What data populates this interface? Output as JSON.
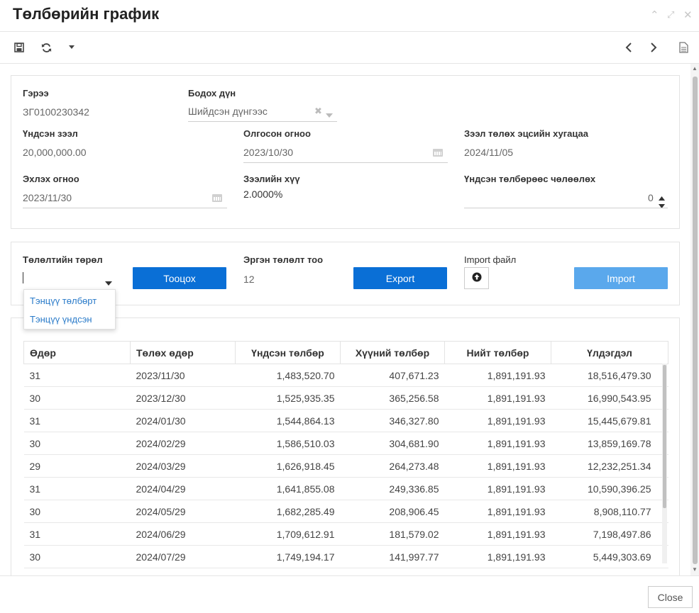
{
  "window": {
    "title": "Төлбөрийн график"
  },
  "icons": {
    "save": "save-icon",
    "refresh": "refresh-icon",
    "more": "caret-down-icon",
    "prev": "chevron-left-icon",
    "next": "chevron-right-icon",
    "doc": "document-icon",
    "upload": "arrow-up-circle-icon",
    "calendar": "calendar-icon"
  },
  "form": {
    "contract": {
      "label": "Гэрээ",
      "value": "ЗГ0100230342"
    },
    "calc_amount": {
      "label": "Бодох дүн",
      "value": "Шийдсэн дүнгээс"
    },
    "principal": {
      "label": "Үндсэн зээл",
      "value": "20,000,000.00"
    },
    "disbursed_date": {
      "label": "Олгосон огноо",
      "value": "2023/10/30"
    },
    "maturity": {
      "label": "Зээл төлөх эцсийн хугацаа",
      "value": "2024/11/05"
    },
    "start_date": {
      "label": "Эхлэх огноо",
      "value": "2023/11/30"
    },
    "interest_rate": {
      "label": "Зээлийн хүү",
      "value": "2.0000%"
    },
    "grace": {
      "label": "Үндсэн төлбөрөөс чөлөөлөх",
      "value": "0"
    }
  },
  "schedule": {
    "payment_type_label": "Төлөлтийн төрөл",
    "payment_type_value": "",
    "payment_type_options": [
      "Тэнцүү төлбөрт",
      "Тэнцүү үндсэн"
    ],
    "calc_button": "Тооцох",
    "count_label": "Эргэн төлөлт тоо",
    "count_value": "12",
    "export_button": "Export",
    "import_label": "Import файл",
    "import_button": "Import"
  },
  "table": {
    "headers": [
      "Өдөр",
      "Төлөх өдөр",
      "Үндсэн төлбөр",
      "Хүүний төлбөр",
      "Нийт төлбөр",
      "Үлдэгдэл"
    ],
    "rows": [
      [
        "31",
        "2023/11/30",
        "1,483,520.70",
        "407,671.23",
        "1,891,191.93",
        "18,516,479.30"
      ],
      [
        "30",
        "2023/12/30",
        "1,525,935.35",
        "365,256.58",
        "1,891,191.93",
        "16,990,543.95"
      ],
      [
        "31",
        "2024/01/30",
        "1,544,864.13",
        "346,327.80",
        "1,891,191.93",
        "15,445,679.81"
      ],
      [
        "30",
        "2024/02/29",
        "1,586,510.03",
        "304,681.90",
        "1,891,191.93",
        "13,859,169.78"
      ],
      [
        "29",
        "2024/03/29",
        "1,626,918.45",
        "264,273.48",
        "1,891,191.93",
        "12,232,251.34"
      ],
      [
        "31",
        "2024/04/29",
        "1,641,855.08",
        "249,336.85",
        "1,891,191.93",
        "10,590,396.25"
      ],
      [
        "30",
        "2024/05/29",
        "1,682,285.49",
        "208,906.45",
        "1,891,191.93",
        "8,908,110.77"
      ],
      [
        "31",
        "2024/06/29",
        "1,709,612.91",
        "181,579.02",
        "1,891,191.93",
        "7,198,497.86"
      ],
      [
        "30",
        "2024/07/29",
        "1,749,194.17",
        "141,997.77",
        "1,891,191.93",
        "5,449,303.69"
      ]
    ]
  },
  "footer": {
    "close_button": "Close"
  }
}
